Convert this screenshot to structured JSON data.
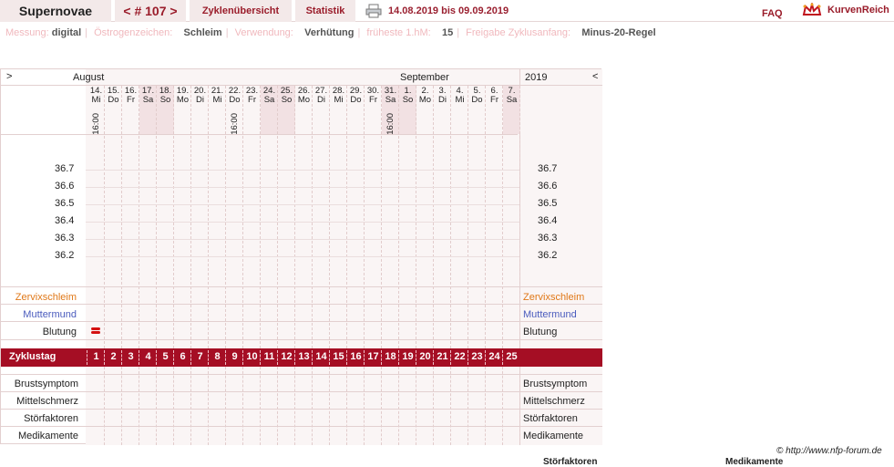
{
  "header": {
    "username": "Supernovae",
    "cycle": "< # 107 >",
    "tab_overview": "Zyklenübersicht",
    "tab_stats": "Statistik",
    "date_range": "14.08.2019 bis 09.09.2019",
    "faq": "FAQ",
    "logo_text": "KurvenReich",
    "print_icon": "printer-icon"
  },
  "settings": [
    {
      "key": "Messung:",
      "value": "digital"
    },
    {
      "key": "Östrogenzeichen:",
      "value": "Schleim"
    },
    {
      "key": "Verwendung:",
      "value": "Verhütung"
    },
    {
      "key": "früheste 1.hM:",
      "value": "15"
    },
    {
      "key": "Freigabe Zyklusanfang:",
      "value": "Minus-20-Regel"
    }
  ],
  "chart": {
    "nav_prev": ">",
    "nav_next": "<",
    "month_left": "August",
    "month_right": "September",
    "year": "2019",
    "days": [
      {
        "d": "14.",
        "w": "Mi",
        "we": false,
        "time": "16:00"
      },
      {
        "d": "15.",
        "w": "Do",
        "we": false
      },
      {
        "d": "16.",
        "w": "Fr",
        "we": false
      },
      {
        "d": "17.",
        "w": "Sa",
        "we": true
      },
      {
        "d": "18.",
        "w": "So",
        "we": true
      },
      {
        "d": "19.",
        "w": "Mo",
        "we": false
      },
      {
        "d": "20.",
        "w": "Di",
        "we": false
      },
      {
        "d": "21.",
        "w": "Mi",
        "we": false
      },
      {
        "d": "22.",
        "w": "Do",
        "we": false,
        "time": "16:00"
      },
      {
        "d": "23.",
        "w": "Fr",
        "we": false
      },
      {
        "d": "24.",
        "w": "Sa",
        "we": true
      },
      {
        "d": "25.",
        "w": "So",
        "we": true
      },
      {
        "d": "26.",
        "w": "Mo",
        "we": false
      },
      {
        "d": "27.",
        "w": "Di",
        "we": false
      },
      {
        "d": "28.",
        "w": "Mi",
        "we": false
      },
      {
        "d": "29.",
        "w": "Do",
        "we": false
      },
      {
        "d": "30.",
        "w": "Fr",
        "we": false
      },
      {
        "d": "31.",
        "w": "Sa",
        "we": true,
        "time": "16:00"
      },
      {
        "d": "1.",
        "w": "So",
        "we": true
      },
      {
        "d": "2.",
        "w": "Mo",
        "we": false
      },
      {
        "d": "3.",
        "w": "Di",
        "we": false
      },
      {
        "d": "4.",
        "w": "Mi",
        "we": false
      },
      {
        "d": "5.",
        "w": "Do",
        "we": false
      },
      {
        "d": "6.",
        "w": "Fr",
        "we": false
      },
      {
        "d": "7.",
        "w": "Sa",
        "we": true
      }
    ],
    "temps": [
      "36.7",
      "36.6",
      "36.5",
      "36.4",
      "36.3",
      "36.2"
    ],
    "rows_top": {
      "cervix": "Zervixschleim",
      "mumu": "Muttermund",
      "bleeding": "Blutung"
    },
    "zyklustag_label": "Zyklustag",
    "cycle_days": [
      "1",
      "2",
      "3",
      "4",
      "5",
      "6",
      "7",
      "8",
      "9",
      "10",
      "11",
      "12",
      "13",
      "14",
      "15",
      "16",
      "17",
      "18",
      "19",
      "20",
      "21",
      "22",
      "23",
      "24",
      "25"
    ],
    "rows_bottom": {
      "breast": "Brustsymptom",
      "midpain": "Mittelschmerz",
      "disturb": "Störfaktoren",
      "meds": "Medikamente"
    },
    "colors": {
      "cervix": "#e07818",
      "mumu": "#4a5bbd",
      "cycle_bar": "#a50e24",
      "bleed": "#d41010"
    },
    "bleeding_day_index": 0
  },
  "footer": {
    "copyright": "© http://www.nfp-forum.de",
    "cut_left": "Störfaktoren",
    "cut_right": "Medikamente"
  }
}
